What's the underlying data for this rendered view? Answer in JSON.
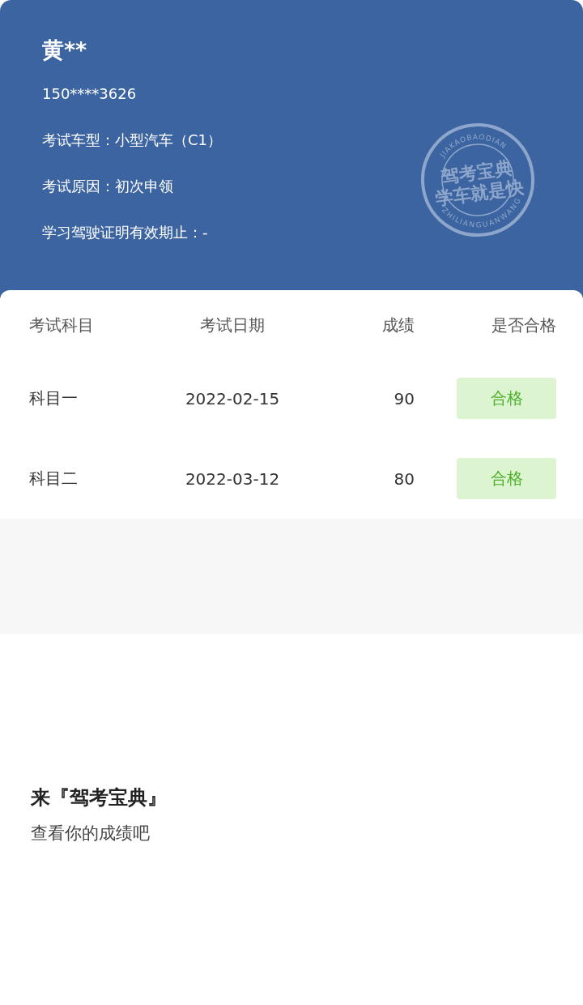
{
  "profile": {
    "name": "黄**",
    "lines": [
      "150****3626",
      "考试车型：小型汽车（C1）",
      "考试原因：初次申领",
      "学习驾驶证明有效期止：-"
    ],
    "seal": {
      "top": "JIAKAOBAODIAN",
      "line_1": "驾考宝典",
      "line_2": "学车就是快",
      "bottom": "ZHILIANGUANWANG"
    }
  },
  "table": {
    "columns": [
      "考试科目",
      "考试日期",
      "成绩",
      "是否合格"
    ],
    "rows": [
      {
        "subject": "科目一",
        "date": "2022-02-15",
        "score": "90",
        "result": "合格",
        "passed": true
      },
      {
        "subject": "科目二",
        "date": "2022-03-12",
        "score": "80",
        "result": "合格",
        "passed": true
      }
    ]
  },
  "promo": {
    "title": "来『驾考宝典』",
    "subtitle": "查看你的成绩吧"
  }
}
